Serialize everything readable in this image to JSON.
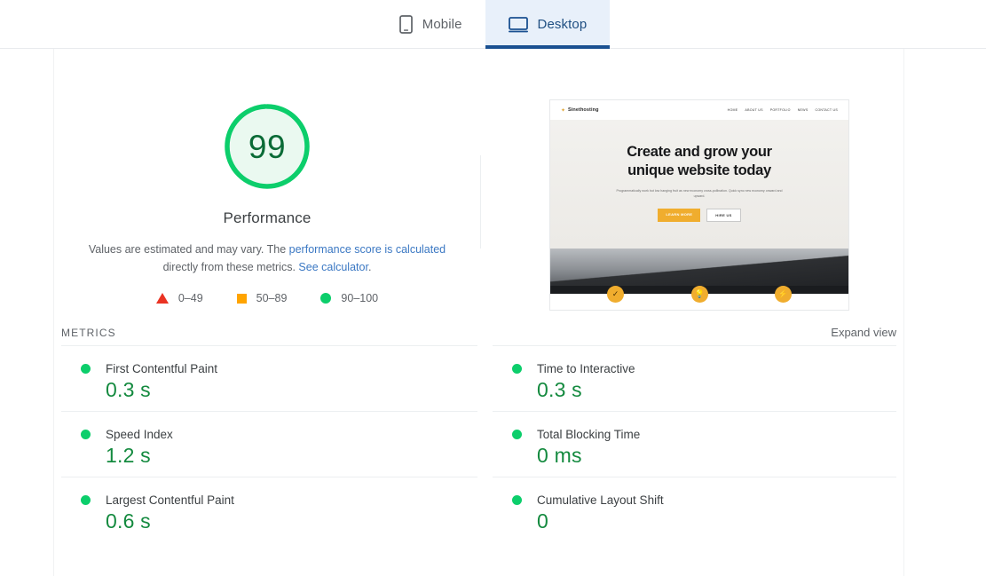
{
  "tabs": [
    {
      "label": "Mobile",
      "icon": "mobile-icon",
      "active": false
    },
    {
      "label": "Desktop",
      "icon": "desktop-icon",
      "active": true
    }
  ],
  "gauge": {
    "score": "99",
    "title": "Performance",
    "desc_part1": "Values are estimated and may vary. The ",
    "desc_link1": "performance score is calculated",
    "desc_part2": " directly from these metrics. ",
    "desc_link2": "See calculator",
    "desc_part3": ".",
    "ring_color": "#0cce6b",
    "fill_color": "#eaf9f0",
    "score_color": "#0a6b36"
  },
  "legend": [
    {
      "shape": "triangle",
      "range": "0–49",
      "color": "#ea3323"
    },
    {
      "shape": "square",
      "range": "50–89",
      "color": "#ffa400"
    },
    {
      "shape": "circle",
      "range": "90–100",
      "color": "#0cce6b"
    }
  ],
  "thumbnail": {
    "logo_text": "Sinethosting",
    "nav": [
      "HOME",
      "ABOUT US",
      "PORTFOLIO",
      "NEWS",
      "CONTACT US"
    ],
    "heading_line1": "Create and grow your",
    "heading_line2": "unique website today",
    "subtext": "Programmatically work but low hanging fruit as new economy cross-pollination. Quick sync new economy onward and upward.",
    "buttons": [
      {
        "label": "LEARN MORE",
        "style": "primary"
      },
      {
        "label": "HIRE US",
        "style": "ghost"
      }
    ],
    "badges": [
      "check-icon",
      "bulb-icon",
      "bolt-icon"
    ]
  },
  "metrics_section": {
    "label": "METRICS",
    "expand_label": "Expand view"
  },
  "metrics": [
    {
      "name": "First Contentful Paint",
      "value": "0.3 s",
      "status": "good"
    },
    {
      "name": "Time to Interactive",
      "value": "0.3 s",
      "status": "good"
    },
    {
      "name": "Speed Index",
      "value": "1.2 s",
      "status": "good"
    },
    {
      "name": "Total Blocking Time",
      "value": "0 ms",
      "status": "good"
    },
    {
      "name": "Largest Contentful Paint",
      "value": "0.6 s",
      "status": "good"
    },
    {
      "name": "Cumulative Layout Shift",
      "value": "0",
      "status": "good"
    }
  ]
}
